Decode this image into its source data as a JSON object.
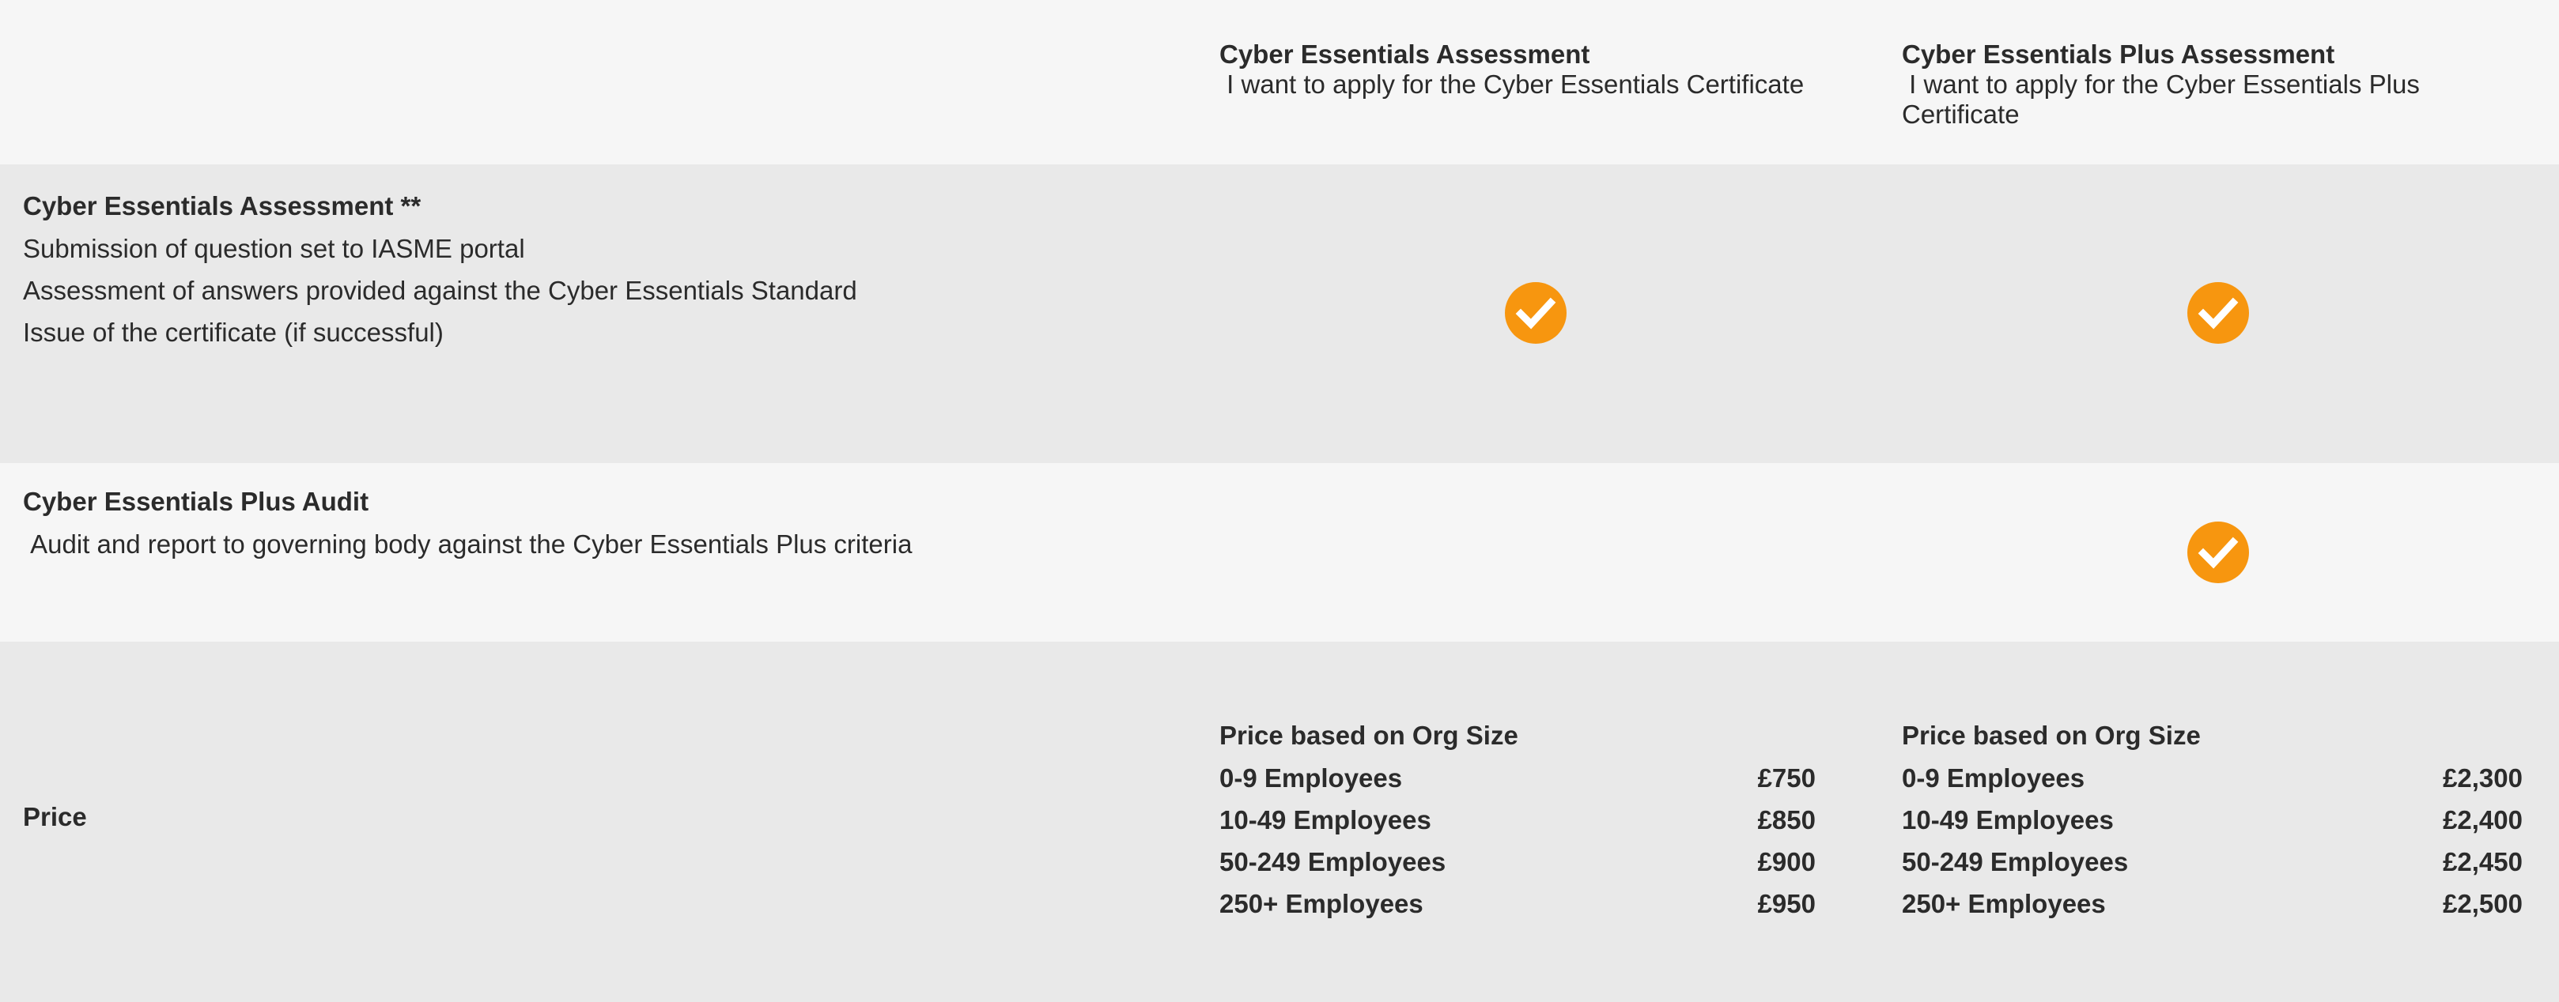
{
  "columns": [
    {
      "title": "Cyber Essentials Assessment",
      "desc": " I want to apply for the Cyber Essentials Certificate"
    },
    {
      "title": "Cyber Essentials Plus Assessment",
      "desc": " I want to apply for the Cyber Essentials Plus Certificate"
    }
  ],
  "features": [
    {
      "title": "Cyber Essentials Assessment **",
      "lines": [
        "Submission of question set to IASME portal",
        "Assessment of answers provided against the Cyber Essentials Standard",
        "Issue of the certificate (if successful)"
      ],
      "included": [
        true,
        true
      ]
    },
    {
      "title": "Cyber Essentials Plus Audit",
      "lines": [
        " Audit and report to governing body against the Cyber Essentials Plus criteria"
      ],
      "included": [
        false,
        true
      ]
    }
  ],
  "price": {
    "label": "Price",
    "blocks": [
      {
        "title": "Price based on Org Size",
        "tiers": [
          {
            "size": "0-9 Employees",
            "amount": "£750"
          },
          {
            "size": "10-49 Employees",
            "amount": "£850"
          },
          {
            "size": "50-249 Employees",
            "amount": "£900"
          },
          {
            "size": "250+ Employees",
            "amount": "£950"
          }
        ]
      },
      {
        "title": "Price based on Org Size",
        "tiers": [
          {
            "size": "0-9 Employees",
            "amount": "£2,300"
          },
          {
            "size": "10-49 Employees",
            "amount": "£2,400"
          },
          {
            "size": "50-249 Employees",
            "amount": "£2,450"
          },
          {
            "size": "250+ Employees",
            "amount": "£2,500"
          }
        ]
      }
    ]
  },
  "icons": {
    "check": "check-circle-icon"
  },
  "colors": {
    "accent": "#f7960f",
    "row_light": "#f6f6f6",
    "row_dark": "#e9e9e9",
    "text": "#2b2b2b"
  }
}
